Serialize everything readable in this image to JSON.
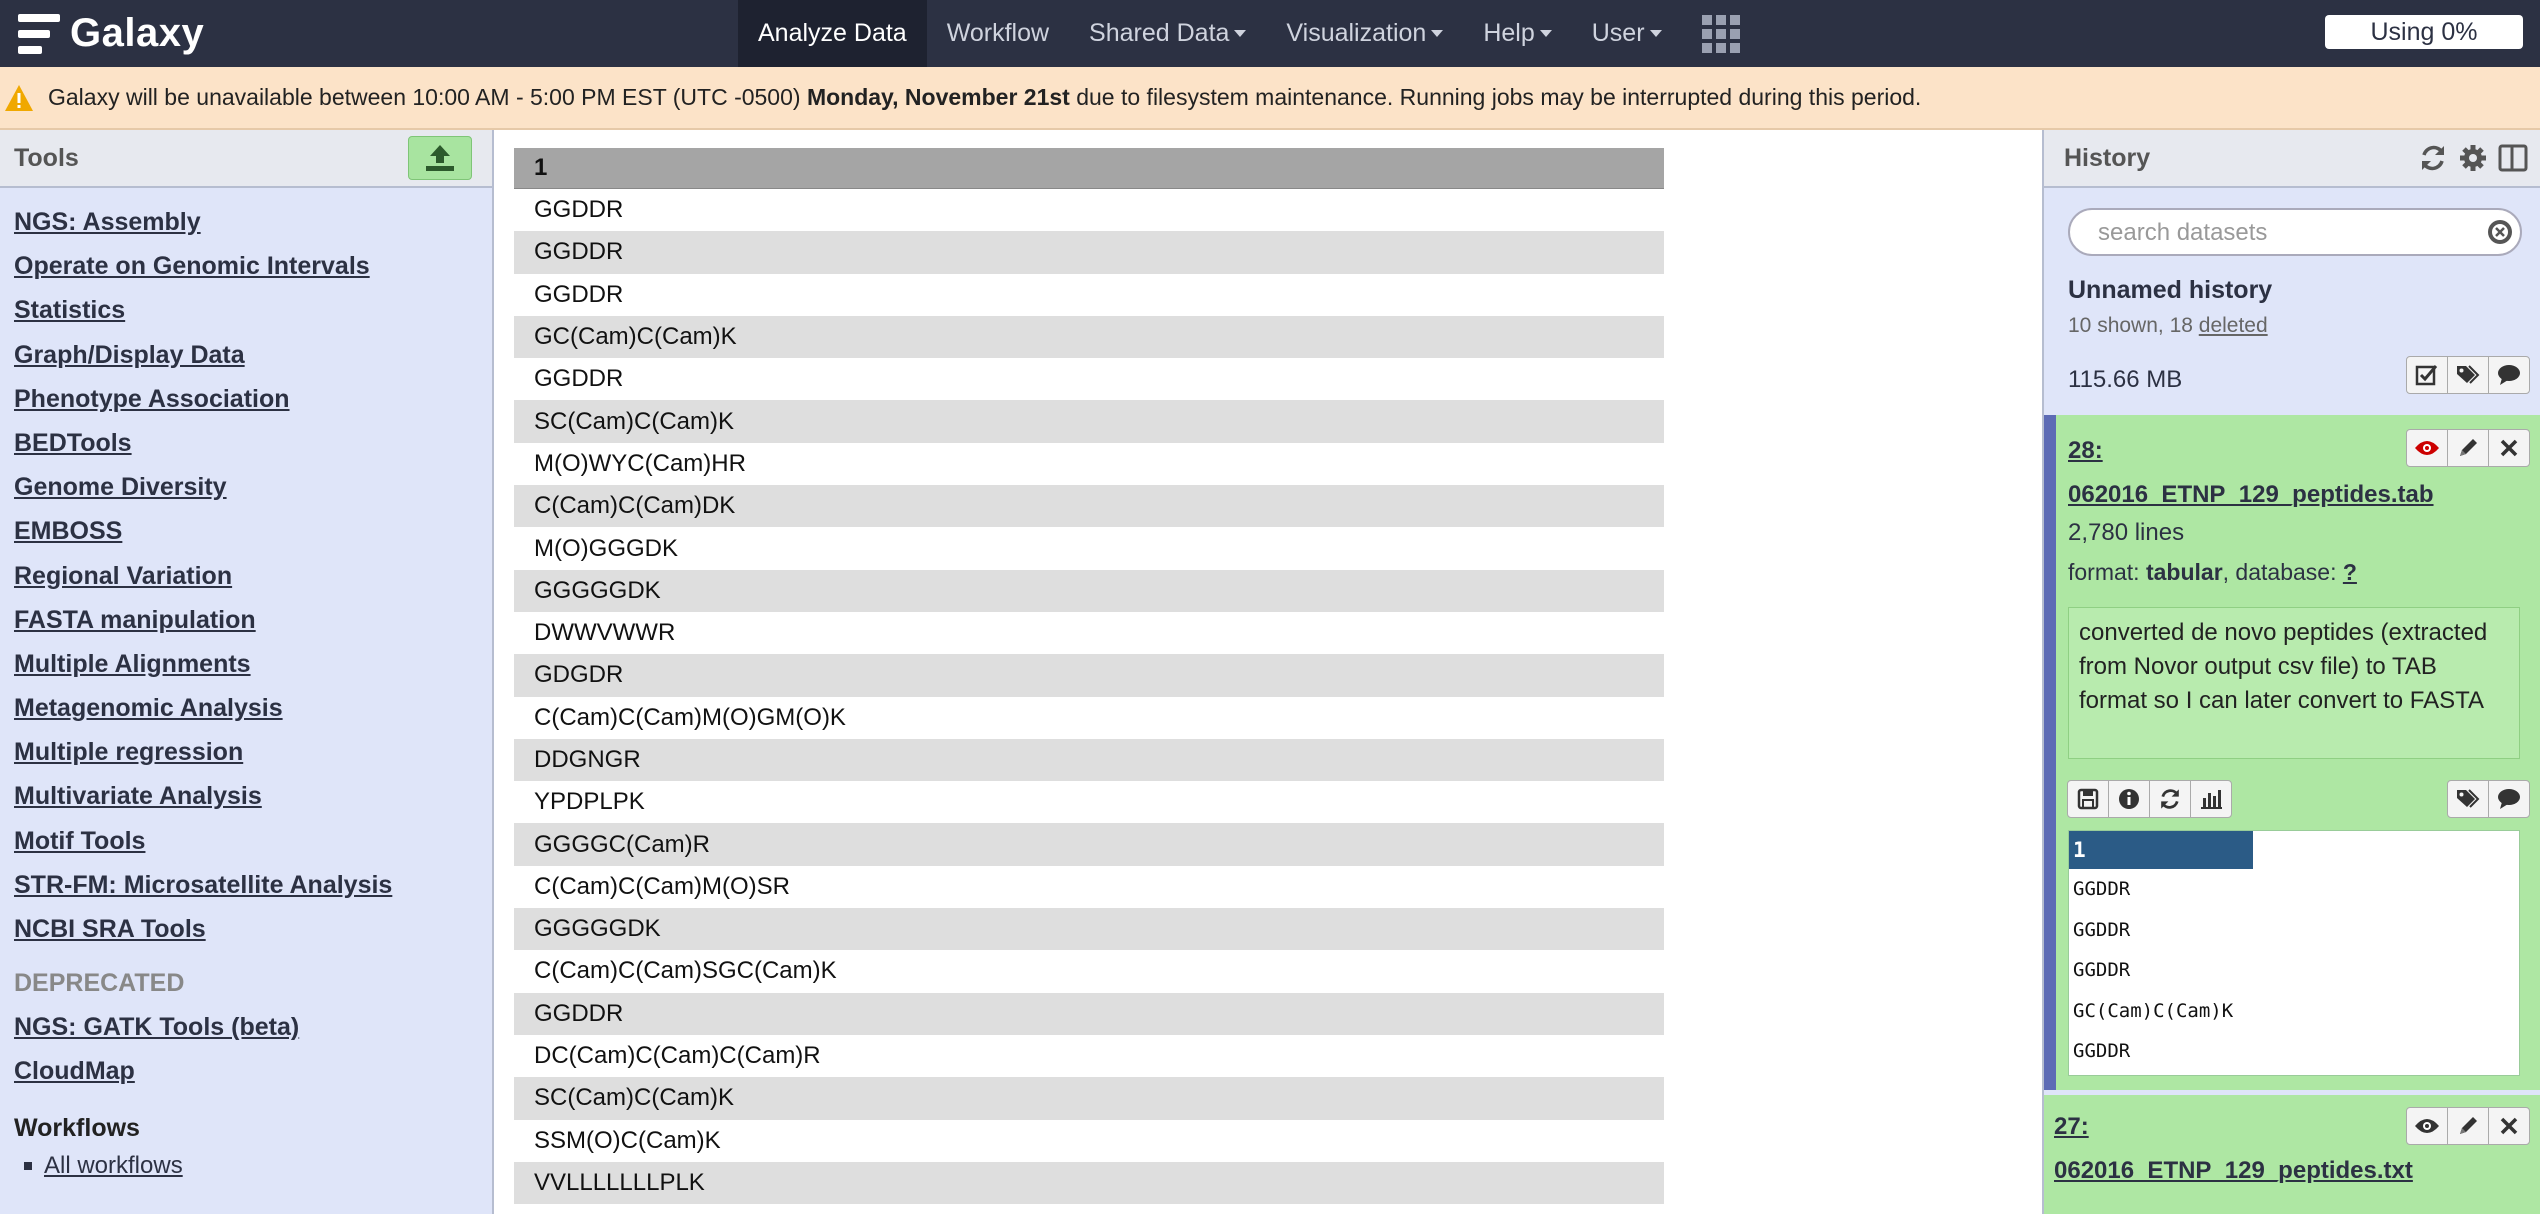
{
  "masthead": {
    "brand": "Galaxy",
    "nav": [
      {
        "label": "Analyze Data",
        "active": true,
        "dropdown": false
      },
      {
        "label": "Workflow",
        "active": false,
        "dropdown": false
      },
      {
        "label": "Shared Data",
        "active": false,
        "dropdown": true
      },
      {
        "label": "Visualization",
        "active": false,
        "dropdown": true
      },
      {
        "label": "Help",
        "active": false,
        "dropdown": true
      },
      {
        "label": "User",
        "active": false,
        "dropdown": true
      }
    ],
    "quota": "Using 0%"
  },
  "notice": {
    "prefix": "Galaxy will be unavailable between 10:00 AM - 5:00 PM EST (UTC -0500) ",
    "bold": "Monday, November 21st",
    "suffix": " due to filesystem maintenance. Running jobs may be interrupted during this period."
  },
  "tools": {
    "title": "Tools",
    "sections": [
      "NGS: Assembly",
      "Operate on Genomic Intervals",
      "Statistics",
      "Graph/Display Data",
      "Phenotype Association",
      "BEDTools",
      "Genome Diversity",
      "EMBOSS",
      "Regional Variation",
      "FASTA manipulation",
      "Multiple Alignments",
      "Metagenomic Analysis",
      "Multiple regression",
      "Multivariate Analysis",
      "Motif Tools",
      "STR-FM: Microsatellite Analysis",
      "NCBI SRA Tools"
    ],
    "deprecated_label": "DEPRECATED",
    "deprecated": [
      "NGS: GATK Tools (beta)",
      "CloudMap"
    ],
    "workflows_label": "Workflows",
    "workflow_link": "All workflows"
  },
  "table": {
    "header": "1",
    "rows": [
      "GGDDR",
      "GGDDR",
      "GGDDR",
      "GC(Cam)C(Cam)K",
      "GGDDR",
      "SC(Cam)C(Cam)K",
      "M(O)WYC(Cam)HR",
      "C(Cam)C(Cam)DK",
      "M(O)GGGDK",
      "GGGGGDK",
      "DWWVWWR",
      "GDGDR",
      "C(Cam)C(Cam)M(O)GM(O)K",
      "DDGNGR",
      "YPDPLPK",
      "GGGGC(Cam)R",
      "C(Cam)C(Cam)M(O)SR",
      "GGGGGDK",
      "C(Cam)C(Cam)SGC(Cam)K",
      "GGDDR",
      "DC(Cam)C(Cam)C(Cam)R",
      "SC(Cam)C(Cam)K",
      "SSM(O)C(Cam)K",
      "VVLLLLLLLPLK"
    ]
  },
  "history": {
    "title": "History",
    "search_placeholder": "search datasets",
    "name": "Unnamed history",
    "counts_prefix": "10 shown, 18 ",
    "deleted_link": "deleted",
    "size": "115.66 MB",
    "datasets": [
      {
        "title_line1": "28:",
        "title_line2": "062016_ETNP_129_peptides.tab",
        "lines": "2,780 lines",
        "format_label": "format: ",
        "format": "tabular",
        "database_label": ", database: ",
        "database": "?",
        "info": "converted de novo peptides (extracted from Novor output csv file) to TAB format so I can later convert to FASTA",
        "peek_header": "1",
        "peek_rows": [
          "GGDDR",
          "GGDDR",
          "GGDDR",
          "GC(Cam)C(Cam)K",
          "GGDDR"
        ]
      },
      {
        "title_line1": "27:",
        "title_line2": "062016_ETNP_129_peptides.txt"
      }
    ]
  }
}
